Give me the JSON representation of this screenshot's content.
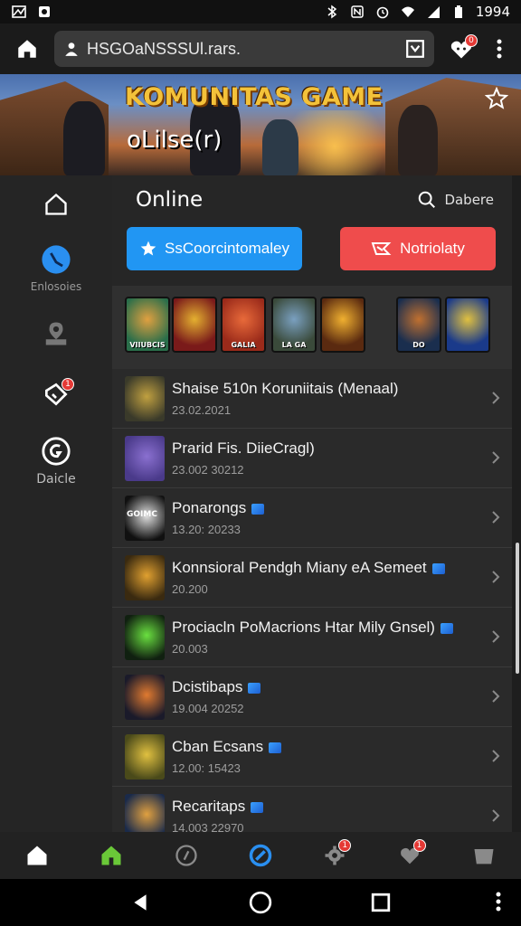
{
  "status_bar": {
    "battery_text": "1994"
  },
  "browser": {
    "url": "HSGOaNSSSUl.rars.",
    "chat_badge": "0"
  },
  "hero": {
    "title": "KOMUNITAS GAME",
    "subtitle": "oLilse(r)"
  },
  "sidebar": {
    "items": [
      {
        "label": "",
        "icon": "home-icon"
      },
      {
        "label": "Enlosoies",
        "icon": "compass-icon"
      },
      {
        "label": "",
        "icon": "location-icon"
      },
      {
        "label": "",
        "icon": "ticket-icon",
        "badge": "1"
      },
      {
        "label": "Daicle",
        "icon": "circle-g-icon"
      }
    ]
  },
  "main": {
    "heading": "Online",
    "search_label": "Dabere",
    "buttons": {
      "primary_label": "SsCoorcintomaley",
      "secondary_label": "Notriolaty"
    }
  },
  "game_strip": [
    {
      "label": "VIIUBCIS",
      "colors": [
        "#2a6e4a",
        "#e0a040"
      ]
    },
    {
      "label": "",
      "colors": [
        "#7a1a1a",
        "#e4b030"
      ]
    },
    {
      "label": "GALIA",
      "colors": [
        "#9a2a1a",
        "#e86a3a"
      ]
    },
    {
      "label": "LA GA",
      "colors": [
        "#3a4a3a",
        "#7aa0c0"
      ]
    },
    {
      "label": "",
      "colors": [
        "#5a2a10",
        "#f0b030"
      ]
    },
    {
      "label": "DO",
      "colors": [
        "#1a2e4e",
        "#c07030"
      ]
    },
    {
      "label": "",
      "colors": [
        "#1a3a8a",
        "#e0c040"
      ]
    }
  ],
  "list": [
    {
      "title": "Shaise 510n Koruniitais (Menaal)",
      "date": "23.02.2021",
      "thumb": [
        "#3a3a2a",
        "#c0a040"
      ],
      "mini_icon": false
    },
    {
      "title": "Prarid Fis. DiieCragl)",
      "date": "23.002 30212",
      "thumb": [
        "#4a3a8a",
        "#8a70d0"
      ],
      "mini_icon": false
    },
    {
      "title": "Ponarongs",
      "date": "13.20: 20233",
      "thumb": [
        "#101010",
        "#e0e0e0"
      ],
      "mini_icon": true,
      "thumb_text": "GOIMC"
    },
    {
      "title": "Konnsioral Pendgh Miany eA Semeet",
      "date": "20.200",
      "thumb": [
        "#3a2a10",
        "#e0a030"
      ],
      "mini_icon": true
    },
    {
      "title": "Prociacln PoMacrions Htar Mily Gnsel)",
      "date": "20.003",
      "thumb": [
        "#102010",
        "#6ae040"
      ],
      "mini_icon": true
    },
    {
      "title": "Dcistibaps",
      "date": "19.004 20252",
      "thumb": [
        "#1a1a2a",
        "#e07a30"
      ],
      "mini_icon": true
    },
    {
      "title": "Cban Ecsans",
      "date": "12.00: 15423",
      "thumb": [
        "#4a4a1a",
        "#e0c040"
      ],
      "mini_icon": true
    },
    {
      "title": "Recaritaps",
      "date": "14.003 22970",
      "thumb": [
        "#1a2a4a",
        "#e0a040"
      ],
      "mini_icon": true
    }
  ],
  "bottom_nav": [
    {
      "icon": "home-icon",
      "color": "#ffffff"
    },
    {
      "icon": "house-green-icon",
      "color": "#6ac838"
    },
    {
      "icon": "g-circle-icon",
      "color": "#8a8a8a"
    },
    {
      "icon": "compass-blue-icon",
      "color": "#2a8ff0"
    },
    {
      "icon": "gear-badge-icon",
      "color": "#8a8a8a",
      "badge": "1"
    },
    {
      "icon": "chat-badge-icon",
      "color": "#8a8a8a",
      "badge": "1"
    },
    {
      "icon": "folder-icon",
      "color": "#8a8a8a"
    }
  ],
  "colors": {
    "accent_blue": "#2196f3",
    "accent_red": "#ef4c4c",
    "background": "#1e1e1e",
    "title_gold": "#f3c23a"
  }
}
